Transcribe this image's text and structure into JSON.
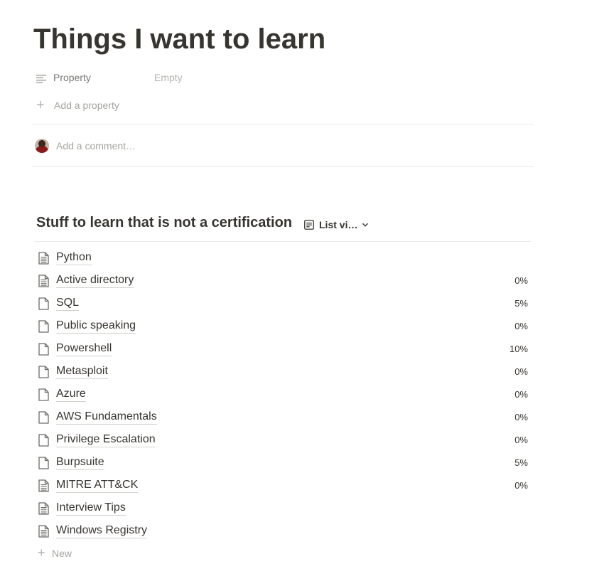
{
  "page": {
    "title": "Things I want to learn"
  },
  "properties": [
    {
      "icon": "text-lines-icon",
      "name": "Property",
      "value": "Empty"
    }
  ],
  "add_property_label": "Add a property",
  "comment": {
    "placeholder": "Add a comment…",
    "avatar_icon": "user-avatar"
  },
  "database": {
    "title": "Stuff to learn that is not a certification",
    "view_label": "List vi…",
    "view_icon": "list-view-icon",
    "items": [
      {
        "name": "Python",
        "progress": "",
        "icon": "page-text-icon"
      },
      {
        "name": "Active directory",
        "progress": "0%",
        "icon": "page-text-icon"
      },
      {
        "name": "SQL",
        "progress": "5%",
        "icon": "page-icon"
      },
      {
        "name": "Public speaking",
        "progress": "0%",
        "icon": "page-icon"
      },
      {
        "name": "Powershell",
        "progress": "10%",
        "icon": "page-icon"
      },
      {
        "name": "Metasploit",
        "progress": "0%",
        "icon": "page-icon"
      },
      {
        "name": "Azure",
        "progress": "0%",
        "icon": "page-icon"
      },
      {
        "name": "AWS Fundamentals",
        "progress": "0%",
        "icon": "page-icon"
      },
      {
        "name": "Privilege Escalation",
        "progress": "0%",
        "icon": "page-icon"
      },
      {
        "name": "Burpsuite",
        "progress": "5%",
        "icon": "page-icon"
      },
      {
        "name": "MITRE ATT&CK",
        "progress": "0%",
        "icon": "page-text-icon"
      },
      {
        "name": "Interview Tips",
        "progress": "",
        "icon": "page-text-icon"
      },
      {
        "name": "Windows Registry",
        "progress": "",
        "icon": "page-text-icon"
      }
    ],
    "new_label": "New"
  },
  "colors": {
    "text": "#37352f",
    "muted": "#a5a4a0",
    "divider": "#e9e9e7"
  }
}
